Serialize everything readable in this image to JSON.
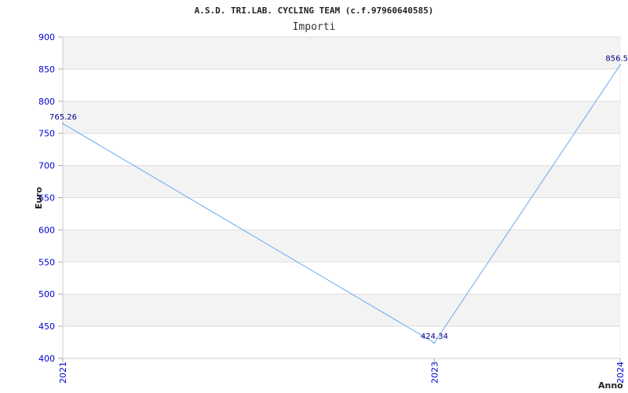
{
  "chart_data": {
    "type": "line",
    "title": "A.S.D. TRI.LAB. CYCLING TEAM (c.f.97960640585)",
    "subtitle": "Importi",
    "xlabel": "Anno",
    "ylabel": "Euro",
    "x": [
      "2021",
      "2023",
      "2024"
    ],
    "x_numeric": [
      2021,
      2023,
      2024
    ],
    "series": [
      {
        "values": [
          765.26,
          424.34,
          856.5
        ],
        "labels": [
          "765.26",
          "424.34",
          "856.5"
        ]
      }
    ],
    "ylim": [
      400,
      900
    ],
    "yticks": [
      400,
      450,
      500,
      550,
      600,
      650,
      700,
      750,
      800,
      850,
      900
    ],
    "grid": true,
    "colors": {
      "line": "#6aaaf0",
      "band": "#f3f3f3",
      "grid": "#dddddd",
      "tick_text": "#0000cc",
      "data_label": "#000088"
    }
  }
}
